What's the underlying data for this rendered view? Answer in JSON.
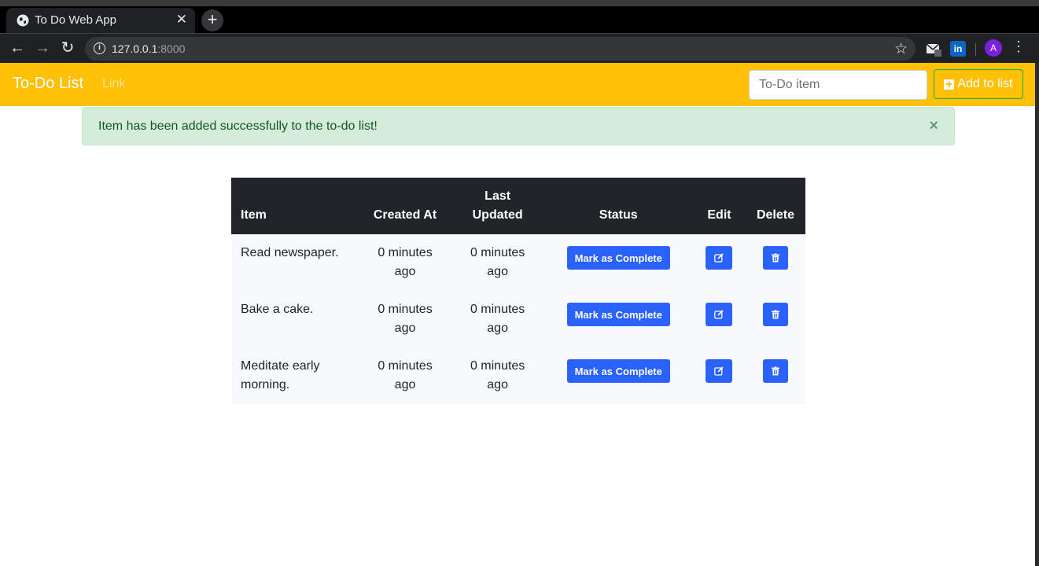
{
  "browser": {
    "tab_title": "To Do Web App",
    "url_host": "127.0.0.1",
    "url_port": ":8000",
    "avatar_letter": "A",
    "linkedin_label": "in",
    "icons": [
      "globe-icon",
      "close-icon",
      "plus-icon",
      "back-icon",
      "forward-icon",
      "reload-icon",
      "info-icon",
      "star-icon",
      "mail-icon",
      "linkedin-icon",
      "kebab-icon"
    ]
  },
  "navbar": {
    "brand": "To-Do List",
    "link": "Link",
    "input_placeholder": "To-Do item",
    "add_label": "Add to list",
    "color": "#ffc107"
  },
  "alert": {
    "message": "Item has been added successfully to the to-do list!",
    "close": "×"
  },
  "table": {
    "headers": {
      "item": "Item",
      "created_at": "Created At",
      "last_updated": "Last Updated",
      "status": "Status",
      "edit": "Edit",
      "delete": "Delete"
    },
    "rows": [
      {
        "item": "Read newspaper.",
        "created_at": "0 minutes ago",
        "last_updated": "0 minutes ago",
        "status_button": "Mark as Complete"
      },
      {
        "item": "Bake a cake.",
        "created_at": "0 minutes ago",
        "last_updated": "0 minutes ago",
        "status_button": "Mark as Complete"
      },
      {
        "item": "Meditate early morning.",
        "created_at": "0 minutes ago",
        "last_updated": "0 minutes ago",
        "status_button": "Mark as Complete"
      }
    ]
  },
  "colors": {
    "primary": "#2962ff",
    "alert_bg": "#d4edda",
    "table_header": "#212529"
  }
}
